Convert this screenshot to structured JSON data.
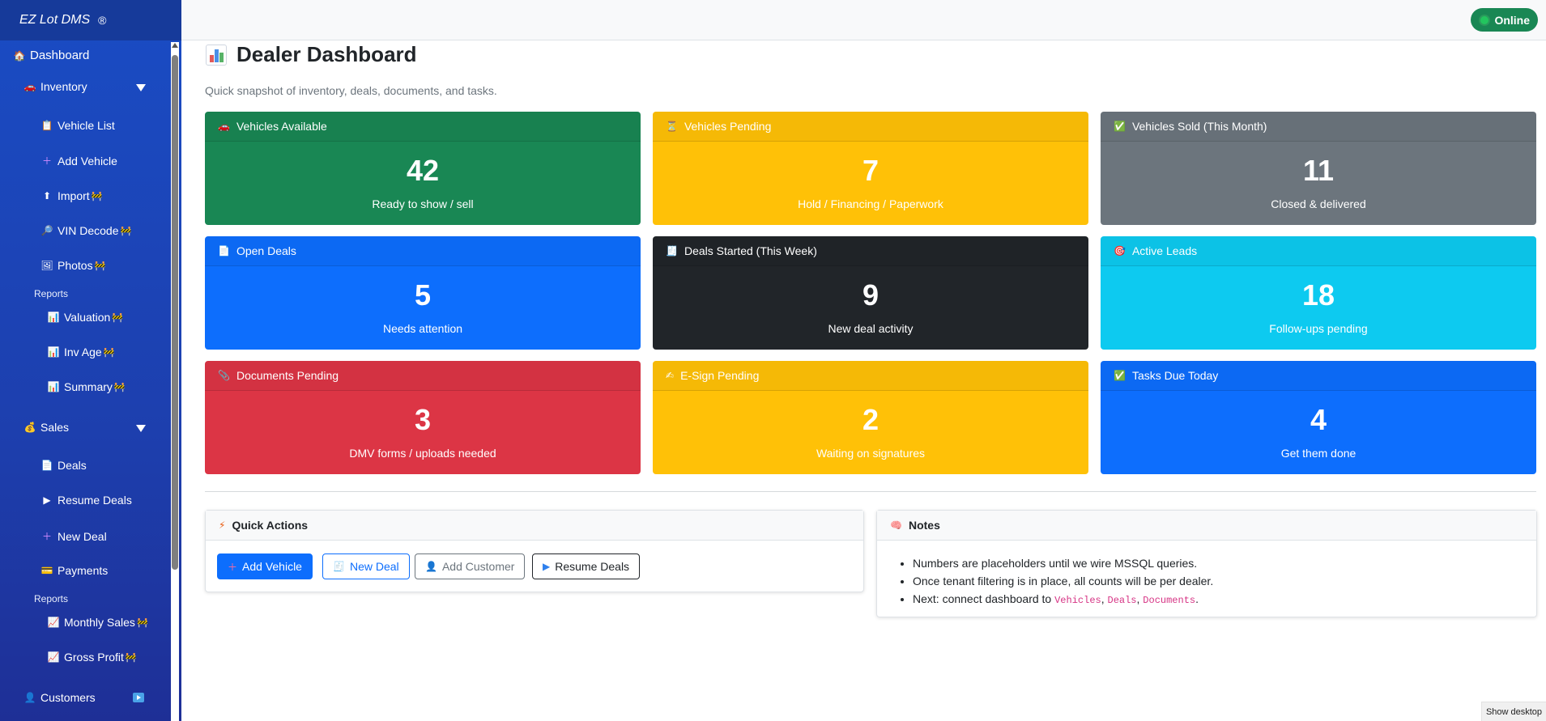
{
  "app": {
    "brand": "EZ Lot DMS",
    "brand_mark": "®",
    "status": "Online"
  },
  "sidebar": {
    "dashboard": "Dashboard",
    "inventory": {
      "label": "Inventory",
      "items": [
        {
          "label": "Vehicle List",
          "icon": "clipboard-icon"
        },
        {
          "label": "Add Vehicle",
          "icon": "plus-icon"
        },
        {
          "label": "Import",
          "icon": "upload-icon",
          "badge": "🚧"
        },
        {
          "label": "VIN Decode",
          "icon": "magnifier-icon",
          "badge": "🚧"
        },
        {
          "label": "Photos",
          "icon": "image-icon",
          "badge": "🚧"
        }
      ],
      "reports_label": "Reports",
      "reports": [
        {
          "label": "Valuation",
          "badge": "🚧"
        },
        {
          "label": "Inv Age",
          "badge": "🚧"
        },
        {
          "label": "Summary",
          "badge": "🚧"
        }
      ]
    },
    "sales": {
      "label": "Sales",
      "items": [
        {
          "label": "Deals",
          "icon": "document-icon"
        },
        {
          "label": "Resume Deals",
          "icon": "play-icon"
        },
        {
          "label": "New Deal",
          "icon": "plus-icon"
        },
        {
          "label": "Payments",
          "icon": "card-icon"
        }
      ],
      "reports_label": "Reports",
      "reports": [
        {
          "label": "Monthly Sales",
          "badge": "🚧"
        },
        {
          "label": "Gross Profit",
          "badge": "🚧"
        }
      ]
    },
    "customers": "Customers"
  },
  "page": {
    "title": "Dealer Dashboard",
    "subtitle": "Quick snapshot of inventory, deals, documents, and tasks."
  },
  "cards": [
    {
      "title": "Vehicles Available",
      "value": "42",
      "sub": "Ready to show / sell",
      "icon": "car-icon",
      "color": "#198754"
    },
    {
      "title": "Vehicles Pending",
      "value": "7",
      "sub": "Hold / Financing / Paperwork",
      "icon": "hourglass-icon",
      "color": "#ffc107"
    },
    {
      "title": "Vehicles Sold (This Month)",
      "value": "11",
      "sub": "Closed & delivered",
      "icon": "check-icon",
      "color": "#6c757d"
    },
    {
      "title": "Open Deals",
      "value": "5",
      "sub": "Needs attention",
      "icon": "document-icon",
      "color": "#0d6efd"
    },
    {
      "title": "Deals Started (This Week)",
      "value": "9",
      "sub": "New deal activity",
      "icon": "receipt-icon",
      "color": "#212529"
    },
    {
      "title": "Active Leads",
      "value": "18",
      "sub": "Follow-ups pending",
      "icon": "target-icon",
      "color": "#0dcaf0"
    },
    {
      "title": "Documents Pending",
      "value": "3",
      "sub": "DMV forms / uploads needed",
      "icon": "paperclip-icon",
      "color": "#dc3545"
    },
    {
      "title": "E-Sign Pending",
      "value": "2",
      "sub": "Waiting on signatures",
      "icon": "pen-icon",
      "color": "#ffc107"
    },
    {
      "title": "Tasks Due Today",
      "value": "4",
      "sub": "Get them done",
      "icon": "check-icon",
      "color": "#0d6efd"
    }
  ],
  "quick_actions": {
    "title": "Quick Actions",
    "buttons": [
      "Add Vehicle",
      "New Deal",
      "Add Customer",
      "Resume Deals"
    ]
  },
  "notes": {
    "title": "Notes",
    "line1": "Numbers are placeholders until we wire MSSQL queries.",
    "line2": "Once tenant filtering is in place, all counts will be per dealer.",
    "line3_prefix": "Next: connect dashboard to ",
    "code1": "Vehicles",
    "sep": ", ",
    "code2": "Deals",
    "code3": "Documents",
    "period": "."
  },
  "taskbar": {
    "show_desktop": "Show desktop"
  }
}
